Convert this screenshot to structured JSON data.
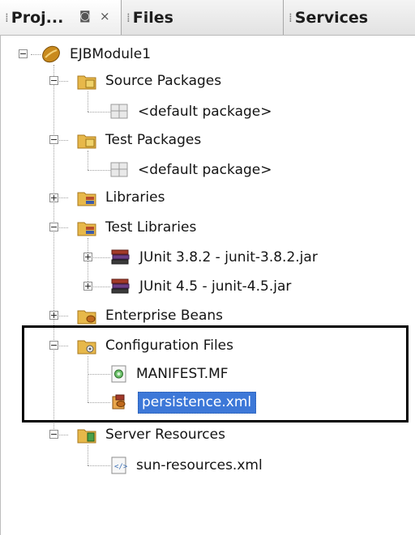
{
  "tabs": [
    {
      "label": "Proj...",
      "active": true
    },
    {
      "label": "Files",
      "active": false
    },
    {
      "label": "Services",
      "active": false
    }
  ],
  "tab_controls": {
    "minimize_icon": "minimize-window-icon",
    "close_icon": "close-icon",
    "minimize_glyph": "◙",
    "close_glyph": "×"
  },
  "tree": {
    "project": "EJBModule1",
    "source_packages": "Source Packages",
    "source_default": "<default package>",
    "test_packages": "Test Packages",
    "test_default": "<default package>",
    "libraries": "Libraries",
    "test_libraries": "Test Libraries",
    "junit3": "JUnit 3.8.2 - junit-3.8.2.jar",
    "junit4": "JUnit 4.5 - junit-4.5.jar",
    "enterprise_beans": "Enterprise Beans",
    "configuration_files": "Configuration Files",
    "manifest": "MANIFEST.MF",
    "persistence": "persistence.xml",
    "server_resources": "Server Resources",
    "sun_resources": "sun-resources.xml"
  },
  "selected_item": "persistence.xml",
  "colors": {
    "selection": "#3d78d8",
    "highlight_box": "#000000"
  }
}
